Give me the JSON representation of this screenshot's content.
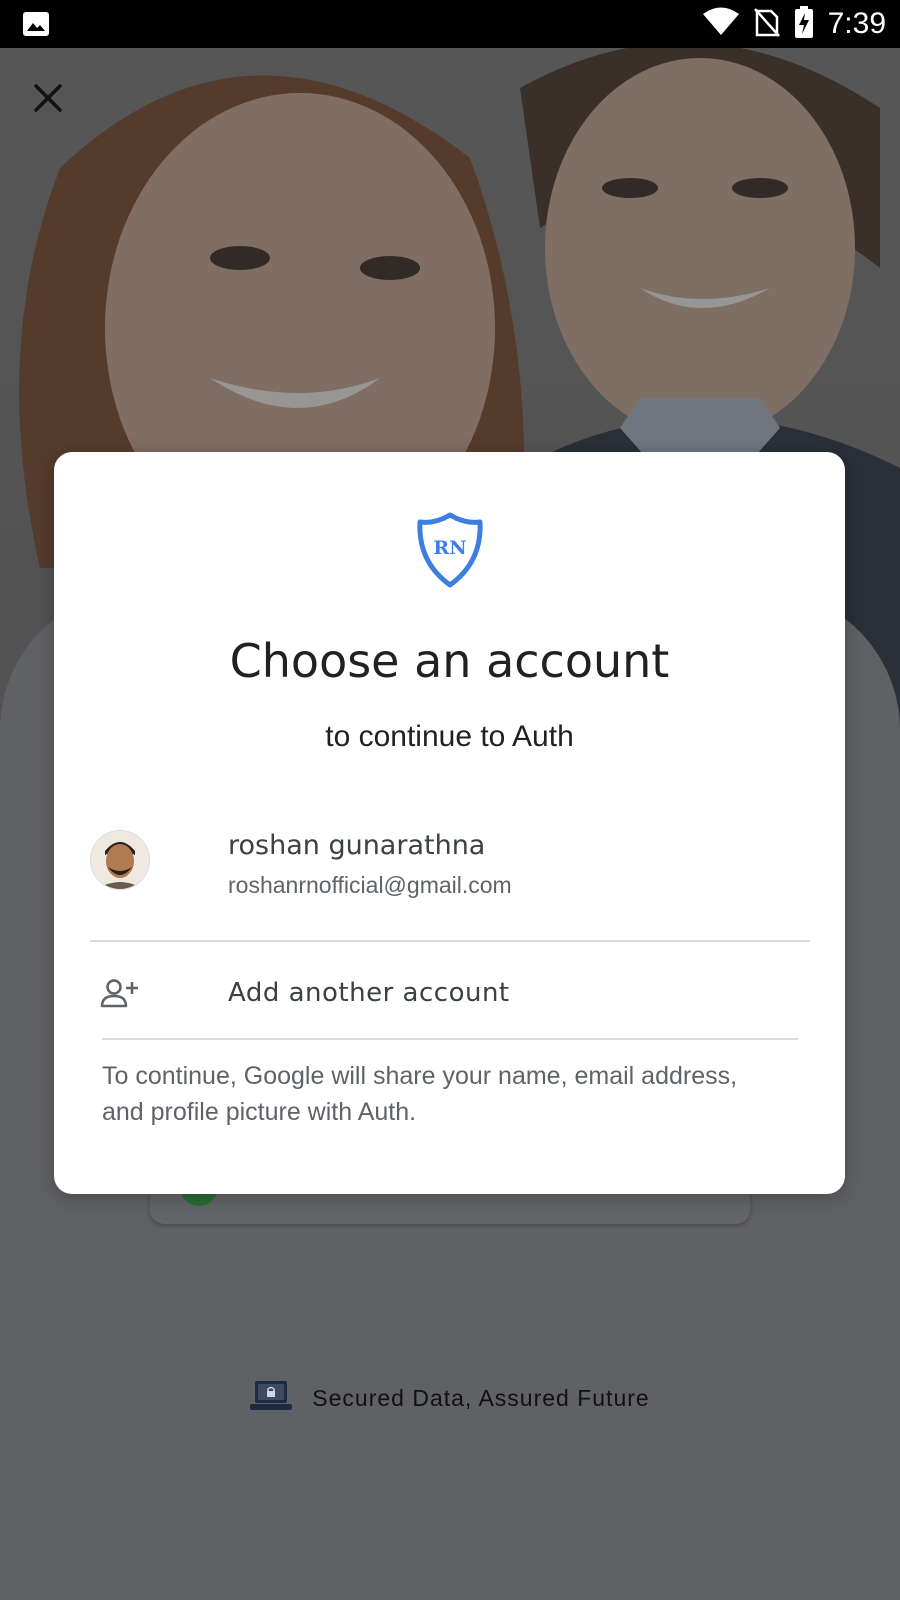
{
  "status_bar": {
    "time": "7:39",
    "icons": [
      "image-notification-icon",
      "wifi-icon",
      "no-sim-icon",
      "battery-charging-icon"
    ]
  },
  "dialog": {
    "logo_text": "RN",
    "title": "Choose an account",
    "subtitle": "to continue to Auth",
    "account": {
      "name": "roshan gunarathna",
      "email": "roshanrnofficial@gmail.com"
    },
    "add_account_label": "Add another account",
    "consent_text": "To continue, Google will share your name, email address, and profile picture with Auth."
  },
  "footer": {
    "tagline": "Secured Data, Assured Future"
  },
  "colors": {
    "brand_blue": "#3b7fe0",
    "overlay": "#5f6063"
  }
}
